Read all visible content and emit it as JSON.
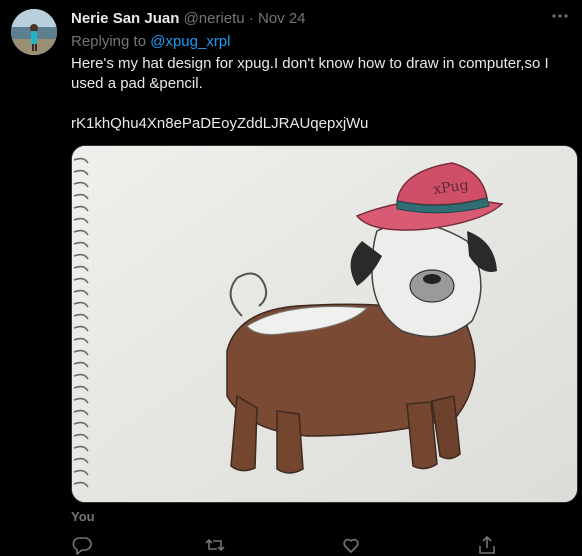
{
  "tweet": {
    "author_name": "Nerie San Juan",
    "author_handle": "@nerietu",
    "separator": "·",
    "date": "Nov 24",
    "replying_prefix": "Replying to",
    "replying_to": "@xpug_xrpl",
    "text_line1": "Here's my hat design for xpug.I don't know how to draw in computer,so I used a pad &pencil.",
    "text_code": "rK1khQhu4Xn8ePaDEoyZddLJRAUqepxjWu",
    "media_label": "xPug",
    "tagged": "You"
  },
  "icons": {
    "more": "more-options-icon",
    "reply": "reply-icon",
    "retweet": "retweet-icon",
    "like": "heart-icon",
    "share": "share-icon"
  },
  "colors": {
    "background": "#000000",
    "text": "#e7e9ea",
    "muted": "#71767b",
    "accent": "#1d9bf0"
  }
}
